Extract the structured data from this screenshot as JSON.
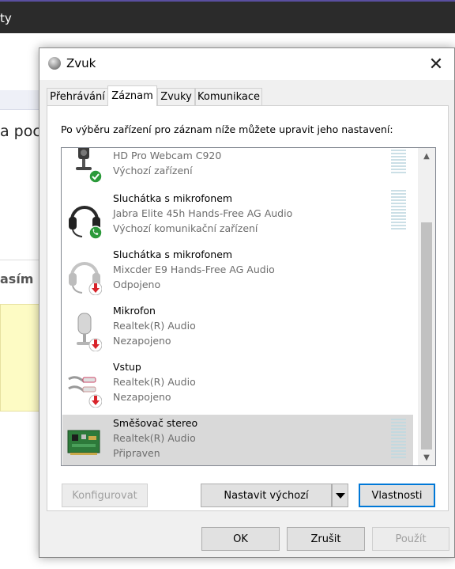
{
  "background": {
    "topbar_text": "ty",
    "text_fragment_1": "a poc",
    "text_fragment_2": "asím ("
  },
  "dialog": {
    "title": "Zvuk",
    "close_label": "✕",
    "tabs": [
      {
        "label": "Přehrávání",
        "active": false
      },
      {
        "label": "Záznam",
        "active": true
      },
      {
        "label": "Zvuky",
        "active": false
      },
      {
        "label": "Komunikace",
        "active": false
      }
    ],
    "instruction": "Po výběru zařízení pro záznam níže můžete upravit jeho nastavení:",
    "devices": [
      {
        "name": "HD Pro Webcam C920",
        "driver": "Výchozí zařízení",
        "status": "",
        "icon": "webcam-icon",
        "badge": "default-check-badge",
        "selected": false
      },
      {
        "name": "Sluchátka s mikrofonem",
        "driver": "Jabra Elite 45h Hands-Free AG Audio",
        "status": "Výchozí komunikační zařízení",
        "icon": "headset-icon",
        "badge": "phone-badge",
        "selected": false
      },
      {
        "name": "Sluchátka s mikrofonem",
        "driver": "Mixcder E9 Hands-Free AG Audio",
        "status": "Odpojeno",
        "icon": "headset-icon",
        "badge": "disconnected-badge",
        "selected": false
      },
      {
        "name": "Mikrofon",
        "driver": "Realtek(R) Audio",
        "status": "Nezapojeno",
        "icon": "microphone-icon",
        "badge": "disconnected-badge",
        "selected": false
      },
      {
        "name": "Vstup",
        "driver": "Realtek(R) Audio",
        "status": "Nezapojeno",
        "icon": "line-in-icon",
        "badge": "disconnected-badge",
        "selected": false
      },
      {
        "name": "Směšovač stereo",
        "driver": "Realtek(R) Audio",
        "status": "Připraven",
        "icon": "sound-card-icon",
        "badge": "",
        "selected": true
      }
    ],
    "buttons": {
      "configure": "Konfigurovat",
      "set_default": "Nastavit výchozí",
      "properties": "Vlastnosti",
      "ok": "OK",
      "cancel": "Zrušit",
      "apply": "Použít"
    },
    "colors": {
      "selection": "#d9d9d9",
      "focus_border": "#0078d7",
      "badge_green": "#2b9a3a",
      "badge_red": "#d8232a"
    }
  }
}
